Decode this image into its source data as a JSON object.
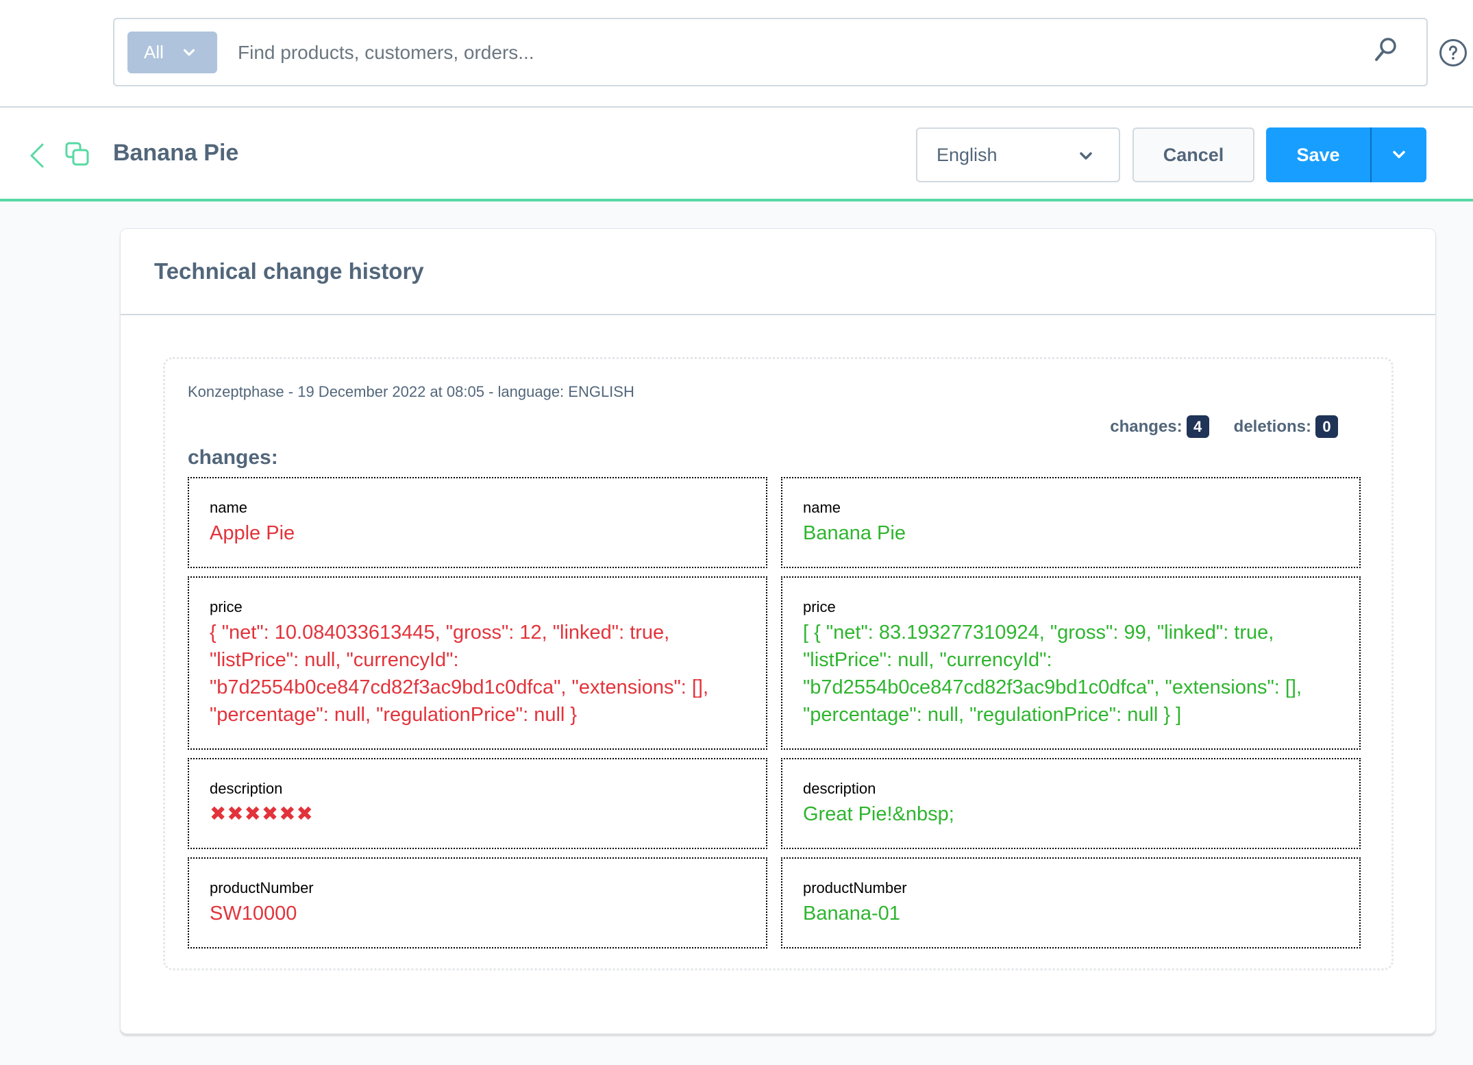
{
  "search": {
    "type_label": "All",
    "placeholder": "Find products, customers, orders...",
    "value": ""
  },
  "header": {
    "title": "Banana Pie",
    "language": "English",
    "cancel_label": "Cancel",
    "save_label": "Save"
  },
  "colors": {
    "accent": "#189eff",
    "brand_green": "#57d9a3",
    "removed": "#e2333b",
    "added": "#2eb52e",
    "badge": "#1f3456"
  },
  "card": {
    "title": "Technical change history"
  },
  "entry": {
    "meta": "Konzeptphase - 19 December 2022 at 08:05 - language: ENGLISH",
    "changes_count_label": "changes:",
    "changes_count": "4",
    "deletions_count_label": "deletions:",
    "deletions_count": "0",
    "changes_heading": "changes:",
    "rows": [
      {
        "field": "name",
        "old": "Apple Pie",
        "new": "Banana Pie"
      },
      {
        "field": "price",
        "old": "{ \"net\": 10.084033613445, \"gross\": 12, \"linked\": true, \"listPrice\": null, \"currencyId\": \"b7d2554b0ce847cd82f3ac9bd1c0dfca\", \"extensions\": [], \"percentage\": null, \"regulationPrice\": null }",
        "new": "[ { \"net\": 83.193277310924, \"gross\": 99, \"linked\": true, \"listPrice\": null, \"currencyId\": \"b7d2554b0ce847cd82f3ac9bd1c0dfca\", \"extensions\": [], \"percentage\": null, \"regulationPrice\": null } ]"
      },
      {
        "field": "description",
        "old": "✖✖✖✖✖✖",
        "new": "Great Pie!&nbsp;"
      },
      {
        "field": "productNumber",
        "old": "SW10000",
        "new": "Banana-01"
      }
    ]
  }
}
